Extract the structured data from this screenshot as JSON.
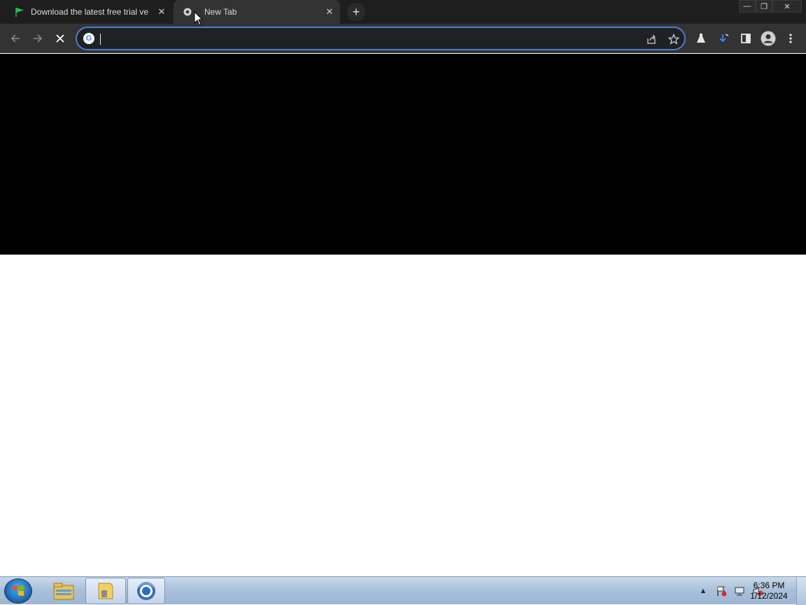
{
  "browser": {
    "tabs": [
      {
        "title": "Download the latest free trial ve",
        "favicon": "green-flag-icon",
        "active": false
      },
      {
        "title": "New Tab",
        "favicon": "chrome-icon",
        "active": true
      }
    ],
    "new_tab_symbol": "+",
    "window_controls": {
      "minimize": "—",
      "restore": "❐",
      "close": "✕"
    },
    "omnibox": {
      "value": "",
      "placeholder": ""
    },
    "toolbar_icons": [
      "back-icon",
      "forward-icon",
      "stop-loading-icon",
      "share-icon",
      "bookmark-star-icon",
      "labs-flask-icon",
      "extension-icon",
      "side-panel-icon",
      "profile-avatar-icon",
      "menu-icon"
    ]
  },
  "taskbar": {
    "clock": {
      "time": "6:36 PM",
      "date": "1/12/2024"
    },
    "pinned": [
      "file-explorer-icon",
      "folder-icon",
      "chrome-icon"
    ]
  },
  "colors": {
    "tabstrip": "#1e1e1e",
    "toolbar": "#333333",
    "omnibox_focus": "#4a7fd4",
    "taskbar": "#a9c0da"
  }
}
